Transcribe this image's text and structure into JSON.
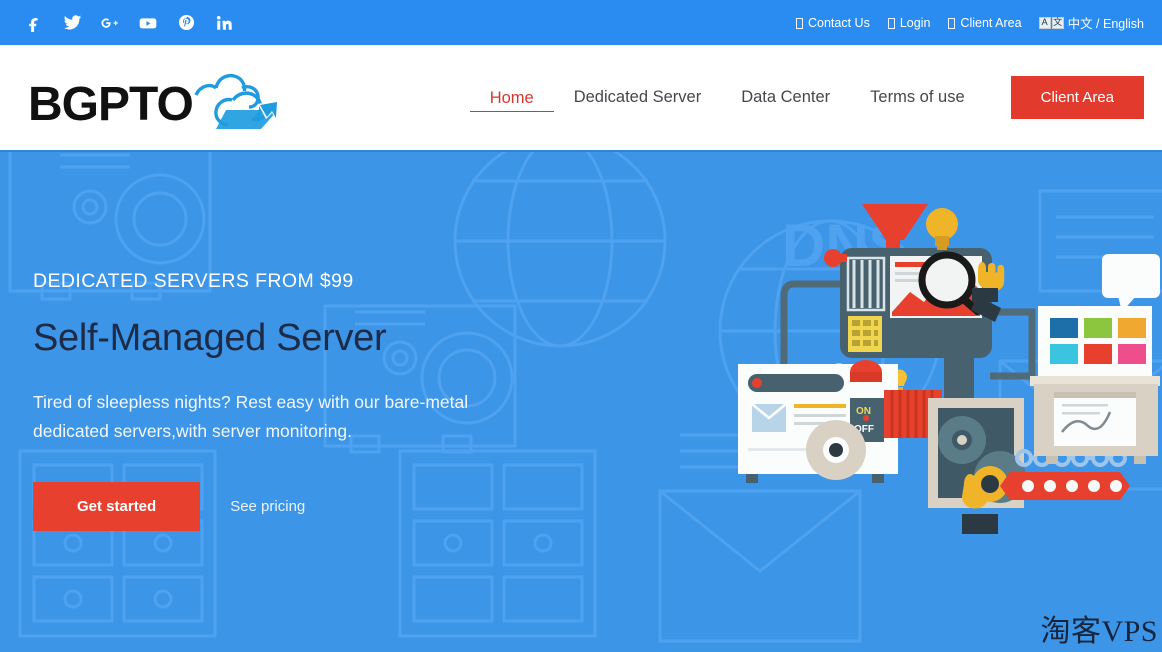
{
  "topbar": {
    "social": [
      {
        "name": "facebook-icon",
        "label": "Facebook"
      },
      {
        "name": "twitter-icon",
        "label": "Twitter"
      },
      {
        "name": "google-plus-icon",
        "label": "Google Plus"
      },
      {
        "name": "youtube-icon",
        "label": "YouTube"
      },
      {
        "name": "pinterest-icon",
        "label": "Pinterest"
      },
      {
        "name": "linkedin-icon",
        "label": "LinkedIn"
      }
    ],
    "links": [
      {
        "label": "Contact Us"
      },
      {
        "label": "Login"
      },
      {
        "label": "Client Area"
      }
    ],
    "language": {
      "icon_left": "A",
      "icon_right": "文",
      "label": "中文 / English"
    }
  },
  "header": {
    "logo_text": "BGPTO",
    "nav": [
      {
        "label": "Home",
        "active": true
      },
      {
        "label": "Dedicated Server",
        "active": false
      },
      {
        "label": "Data Center",
        "active": false
      },
      {
        "label": "Terms of use",
        "active": false
      }
    ],
    "client_area_button": "Client Area"
  },
  "hero": {
    "eyebrow": "DEDICATED SERVERS FROM $99",
    "headline": "Self-Managed Server",
    "subtext": "Tired of sleepless nights? Rest easy with our bare-metal dedicated servers,with server monitoring.",
    "primary_cta": "Get started",
    "secondary_cta": "See pricing",
    "background_pattern_text": "DNS",
    "watermark": "淘客VPS"
  },
  "colors": {
    "topbar_blue": "#2a8cf0",
    "hero_blue": "#3d95e8",
    "hero_pattern_blue": "#4c9fee",
    "accent_red": "#e23b2e",
    "cta_red": "#e8402e",
    "nav_active_red": "#d7362f",
    "headline_navy": "#1d2b47",
    "logo_black": "#111111",
    "logo_blue": "#1f9ce0"
  }
}
